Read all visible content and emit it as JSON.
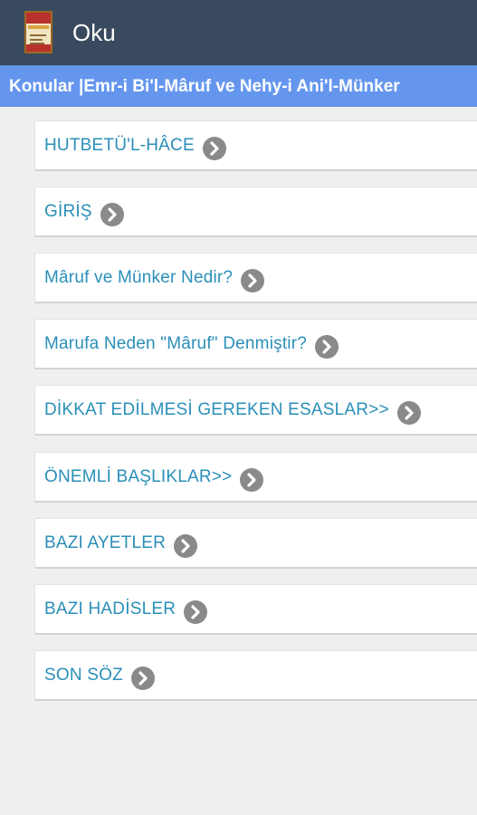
{
  "actionbar": {
    "title": "Oku",
    "icon": "book-cover-icon"
  },
  "subheader": {
    "text": "Konular |Emr-i Bi'l-Mâruf ve Nehy-i Ani'l-Münker"
  },
  "topics": [
    {
      "label": "HUTBETÜ'L-HÂCE",
      "icon": "chevron-right-circle-icon"
    },
    {
      "label": "GİRİŞ",
      "icon": "chevron-right-circle-icon"
    },
    {
      "label": "Mâruf ve Münker Nedir?",
      "icon": "chevron-right-circle-icon"
    },
    {
      "label": "Marufa Neden \"Mâruf\" Denmiştir?",
      "icon": "chevron-right-circle-icon"
    },
    {
      "label": "DİKKAT EDİLMESİ GEREKEN ESASLAR>>",
      "icon": "chevron-right-circle-icon"
    },
    {
      "label": "ÖNEMLİ BAŞLIKLAR>>",
      "icon": "chevron-right-circle-icon"
    },
    {
      "label": "BAZI AYETLER",
      "icon": "chevron-right-circle-icon"
    },
    {
      "label": "BAZI HADİSLER",
      "icon": "chevron-right-circle-icon"
    },
    {
      "label": "SON SÖZ",
      "icon": "chevron-right-circle-icon"
    }
  ],
  "colors": {
    "actionbar_bg": "#3a4a5e",
    "subheader_bg": "#6596ee",
    "link_text": "#2a8fb8",
    "chevron_bg": "#8a8a8a",
    "page_bg": "#efefef"
  }
}
